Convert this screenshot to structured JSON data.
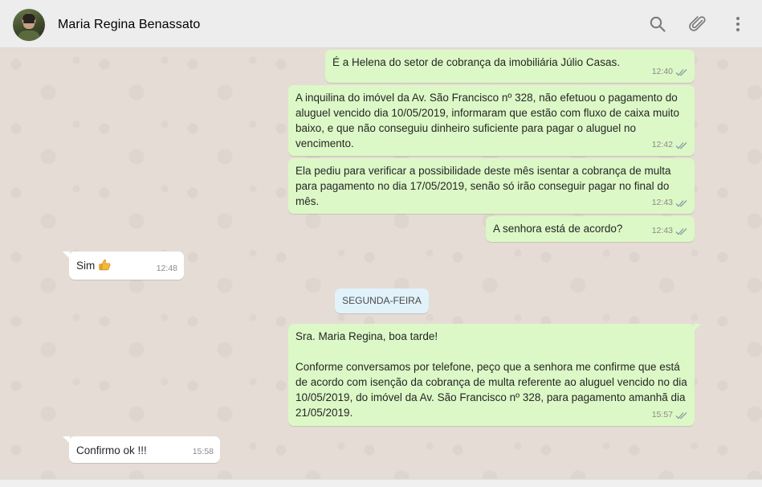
{
  "header": {
    "contact_name": "Maria Regina Benassato",
    "icons": [
      "search-icon",
      "attach-icon",
      "menu-icon"
    ]
  },
  "colors": {
    "outgoing_bubble": "#dcf8c6",
    "incoming_bubble": "#ffffff",
    "chat_background": "#e5ddd5",
    "header_background": "#ededed",
    "day_pill": "#e1f2fb"
  },
  "messages": [
    {
      "direction": "out",
      "text": "É a Helena do setor de cobrança da imobiliária Júlio Casas.",
      "time": "12:40",
      "status": "read"
    },
    {
      "direction": "out",
      "text": "A inquilina do imóvel da Av. São Francisco nº 328, não efetuou o pagamento do aluguel vencido dia 10/05/2019, informaram que estão com fluxo de caixa muito baixo, e que não conseguiu dinheiro suficiente para pagar o aluguel no vencimento.",
      "time": "12:42",
      "status": "read"
    },
    {
      "direction": "out",
      "text": "Ela pediu para verificar a possibilidade deste mês isentar a cobrança de multa para pagamento no dia 17/05/2019, senão só irão conseguir pagar no final do mês.",
      "time": "12:43",
      "status": "read"
    },
    {
      "direction": "out",
      "text": "A senhora está de acordo?",
      "time": "12:43",
      "status": "read"
    },
    {
      "direction": "in",
      "text": "Sim",
      "emoji": "thumbs-up",
      "time": "12:48"
    },
    {
      "direction": "out",
      "text": "Sra. Maria Regina, boa tarde!\n\nConforme conversamos por telefone, peço que a senhora me confirme que está de acordo com isenção da cobrança de multa referente ao aluguel vencido no dia 10/05/2019, do imóvel da Av. São Francisco nº 328, para pagamento amanhã dia 21/05/2019.",
      "time": "15:57",
      "status": "read"
    },
    {
      "direction": "in",
      "text": "Confirmo ok !!!",
      "time": "15:58"
    }
  ],
  "day_separator": "SEGUNDA-FEIRA"
}
